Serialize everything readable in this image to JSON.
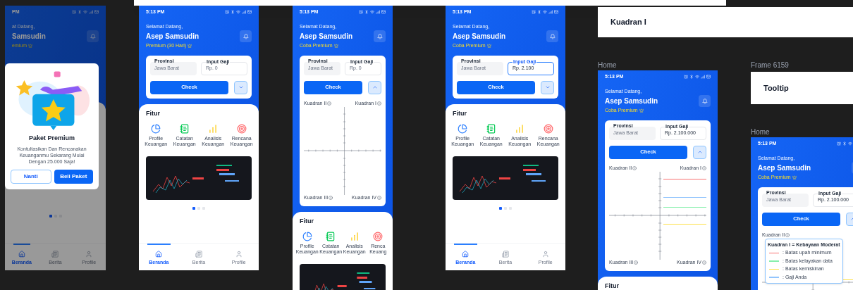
{
  "title_cards": [
    {
      "text": "Kuadran I"
    },
    {
      "label": "Frame 6159",
      "text": "Tooltip"
    }
  ],
  "phones": [
    {
      "time": "PM",
      "greeting": "at Datang,",
      "name": "Samsudin",
      "membership": "emium",
      "panel": true,
      "dots": [
        {
          "selected": true
        },
        {
          "selected": false
        },
        {
          "selected": false
        }
      ],
      "nav": [
        {
          "label": "Beranda",
          "kind": "home",
          "selected": true
        },
        {
          "label": "Berita",
          "kind": "news",
          "selected": false
        },
        {
          "label": "Profile",
          "kind": "profile",
          "selected": false
        }
      ],
      "modal": {
        "title": "Paket Premium",
        "text": "Kontultasikan Dan Rencanakan Keuanganmu Sekarang Mulai Dengan 25.000 Saja!",
        "buttons": [
          {
            "label": "Nanti",
            "kind": "outline"
          },
          {
            "label": "Beli Paket",
            "kind": "primary"
          }
        ]
      }
    },
    {
      "time": "5:13 PM",
      "greeting": "Selamat Datang,",
      "name": "Asep Samsudin",
      "membership": "Premium (30 Hari)",
      "form": {
        "province_label": "Provinsi",
        "province_value": "Jawa Barat",
        "salary_label": "Input Gaji",
        "salary_placeholder": "Rp. 0",
        "salary_focused": false,
        "check": "Check",
        "expanded": false
      },
      "panel": true,
      "fitur": {
        "title": "Fitur",
        "features": [
          {
            "label": "Profile Keuangan",
            "kind": "profile"
          },
          {
            "label": "Catatan Keuangan",
            "kind": "notes"
          },
          {
            "label": "Analisis Keuangan",
            "kind": "analysis"
          },
          {
            "label": "Rencana Keuangan",
            "kind": "plan"
          }
        ]
      },
      "banner": true,
      "dots": [
        {
          "selected": true
        },
        {
          "selected": false
        },
        {
          "selected": false
        }
      ],
      "nav": [
        {
          "label": "Beranda",
          "kind": "home",
          "selected": true
        },
        {
          "label": "Berita",
          "kind": "news",
          "selected": false
        },
        {
          "label": "Profile",
          "kind": "profile",
          "selected": false
        }
      ]
    },
    {
      "time": "5:13 PM",
      "greeting": "Selamat Datang,",
      "name": "Asep Samsudin",
      "membership": "Coba Premium",
      "form": {
        "province_label": "Provinsi",
        "province_value": "Jawa Barat",
        "salary_label": "Input Gaji",
        "salary_placeholder": "Rp. 0",
        "salary_focused": false,
        "check": "Check",
        "expanded": true
      },
      "chart": {
        "quadrants": [
          {
            "text": "Kuadran II",
            "kind": "q2"
          },
          {
            "text": "Kuadran I",
            "kind": "q1"
          },
          {
            "text": "Kuadran III",
            "kind": "q3"
          },
          {
            "text": "Kuadran IV",
            "kind": "q4"
          }
        ]
      },
      "panel": true,
      "fitur": {
        "title": "Fitur",
        "features": [
          {
            "label": "Profile Keuangan",
            "kind": "profile"
          },
          {
            "label": "Catatan Keuangan",
            "kind": "notes"
          },
          {
            "label": "Analisis Keuangan",
            "kind": "analysis"
          },
          {
            "label": "Renca Keuang",
            "kind": "plan"
          }
        ]
      },
      "banner": true
    },
    {
      "time": "5:13 PM",
      "greeting": "Selamat Datang,",
      "name": "Asep Samsudin",
      "membership": "Coba Premium",
      "form": {
        "province_label": "Provinsi",
        "province_value": "Jawa Barat",
        "salary_label": "Input Gaji",
        "salary_value": "Rp. 2.100",
        "salary_focused": true,
        "check": "Check",
        "expanded": false
      },
      "panel": true,
      "fitur": {
        "title": "Fitur",
        "features": [
          {
            "label": "Profile Keuangan",
            "kind": "profile"
          },
          {
            "label": "Catatan Keuangan",
            "kind": "notes"
          },
          {
            "label": "Analisis Keuangan",
            "kind": "analysis"
          },
          {
            "label": "Rencana Keuangan",
            "kind": "plan"
          }
        ]
      },
      "banner": true,
      "dots": [
        {
          "selected": true
        },
        {
          "selected": false
        },
        {
          "selected": false
        }
      ],
      "nav": [
        {
          "label": "Beranda",
          "kind": "home",
          "selected": true
        },
        {
          "label": "Berita",
          "kind": "news",
          "selected": false
        },
        {
          "label": "Profile",
          "kind": "profile",
          "selected": false
        }
      ]
    },
    {
      "label": "Home",
      "time": "5:13 PM",
      "greeting": "Selamat Datang,",
      "name": "Asep Samsudin",
      "membership": "Coba Premium",
      "form": {
        "province_label": "Provinsi",
        "province_value": "Jawa Barat",
        "salary_label": "Input Gaji",
        "salary_value": "Rp. 2.100.000",
        "salary_focused": false,
        "check": "Check",
        "expanded": true
      },
      "chart": {
        "quadrants": [
          {
            "text": "Kuadran II",
            "kind": "q2"
          },
          {
            "text": "Kuadran I",
            "kind": "q1"
          },
          {
            "text": "Kuadran III",
            "kind": "q3"
          },
          {
            "text": "Kuadran IV",
            "kind": "q4"
          }
        ],
        "lines": [
          {
            "kind": "minimum",
            "color": "#f87171"
          },
          {
            "kind": "salary",
            "color": "#93c5fd"
          },
          {
            "kind": "decent",
            "color": "#86efac"
          },
          {
            "kind": "poverty",
            "color": "#fde047"
          }
        ]
      },
      "panel": true,
      "fitur": {
        "title": "Fitur"
      }
    },
    {
      "label": "Home",
      "time": "5:13 PM",
      "greeting": "Selamat Datang,",
      "name": "Asep Samsudin",
      "membership": "Coba Premium",
      "form": {
        "province_label": "Provinsi",
        "province_value": "Jawa Barat",
        "salary_label": "Input Gaji",
        "salary_value": "Rp. 2.100.000",
        "salary_focused": false,
        "check": "Check",
        "expanded": true
      },
      "chart": {
        "quadrants": [
          {
            "text": "Kuadran II",
            "kind": "q2"
          }
        ],
        "lines": [
          {
            "kind": "poverty",
            "color": "#fde047"
          }
        ],
        "tooltip": {
          "title": "Kuadran I = Kebayaan Moderat",
          "rows": [
            {
              "color": "#f87171",
              "text": ": Batas upah minimum"
            },
            {
              "color": "#86efac",
              "text": ": Batas kelayakan data"
            },
            {
              "color": "#fde047",
              "text": ": Batas kemiskinan"
            },
            {
              "color": "#93c5fd",
              "text": ": Gaji Anda"
            }
          ]
        }
      }
    }
  ]
}
